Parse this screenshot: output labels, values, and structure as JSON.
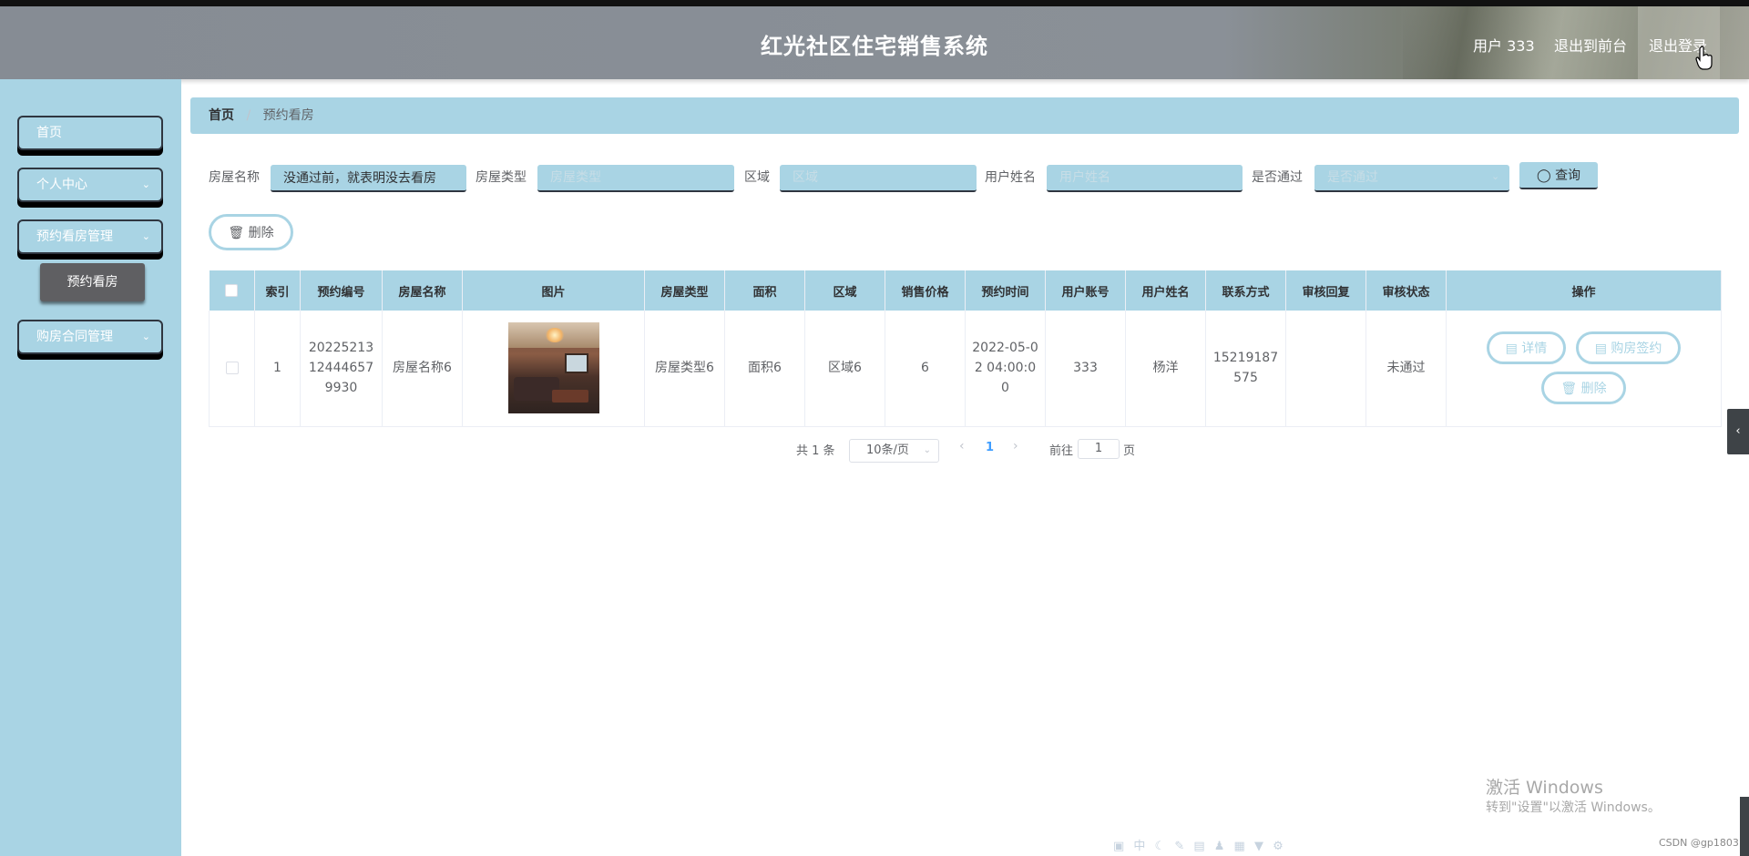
{
  "header": {
    "title": "红光社区住宅销售系统",
    "user": "用户 333",
    "exit_front": "退出到前台",
    "logout": "退出登录"
  },
  "sidebar": {
    "items": [
      {
        "label": "首页"
      },
      {
        "label": "个人中心"
      },
      {
        "label": "预约看房管理"
      },
      {
        "label": "购房合同管理"
      }
    ],
    "active_sub": "预约看房"
  },
  "breadcrumb": {
    "home": "首页",
    "separator": "/",
    "current": "预约看房"
  },
  "search": {
    "house_name_label": "房屋名称",
    "house_name_value": "没通过前，就表明没去看房",
    "house_type_label": "房屋类型",
    "house_type_placeholder": "房屋类型",
    "area_label": "区域",
    "area_placeholder": "区域",
    "username_label": "用户姓名",
    "username_placeholder": "用户姓名",
    "passed_label": "是否通过",
    "passed_placeholder": "是否通过",
    "query_label": "查询"
  },
  "toolbar": {
    "delete_label": "删除"
  },
  "table": {
    "columns": [
      "索引",
      "预约编号",
      "房屋名称",
      "图片",
      "房屋类型",
      "面积",
      "区域",
      "销售价格",
      "预约时间",
      "用户账号",
      "用户姓名",
      "联系方式",
      "审核回复",
      "审核状态",
      "操作"
    ],
    "rows": [
      {
        "index": "1",
        "booking_no": "20225213124446579930",
        "house_name": "房屋名称6",
        "house_type": "房屋类型6",
        "area_size": "面积6",
        "region": "区域6",
        "price": "6",
        "booking_time": "2022-05-02 04:00:00",
        "account": "333",
        "username": "杨洋",
        "phone": "15219187575",
        "review_reply": "",
        "review_status": "未通过",
        "actions": {
          "detail": "详情",
          "contract": "购房签约",
          "delete": "删除"
        }
      }
    ]
  },
  "pagination": {
    "total": "共 1 条",
    "page_size": "10条/页",
    "current_page": "1",
    "goto_label": "前往",
    "goto_value": "1",
    "page_suffix": "页"
  },
  "watermark": {
    "line1": "激活 Windows",
    "line2": "转到\"设置\"以激活 Windows。"
  },
  "footer": {
    "credit": "CSDN @gp1803"
  },
  "colors": {
    "accent": "#a9d4e4",
    "header": "#868c94",
    "active_sub": "#5f5f62",
    "page_active": "#409eff"
  }
}
